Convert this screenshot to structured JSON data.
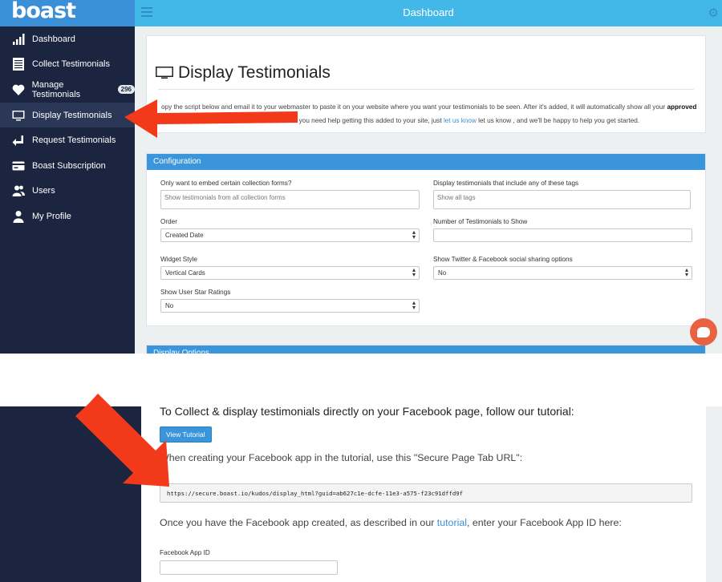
{
  "brand": {
    "logo_text": "boast",
    "color": "#3a8fd6"
  },
  "topbar": {
    "title": "Dashboard",
    "menu_icon": "hamburger-icon",
    "settings_icon": "gear-icon"
  },
  "sidebar": {
    "items": [
      {
        "label": "Dashboard",
        "icon": "bar-chart-icon"
      },
      {
        "label": "Collect Testimonials",
        "icon": "document-icon"
      },
      {
        "label": "Manage Testimonials",
        "icon": "heart-icon",
        "badge": "296"
      },
      {
        "label": "Display Testimonials",
        "icon": "monitor-icon",
        "active": true
      },
      {
        "label": "Request Testimonials",
        "icon": "request-icon"
      },
      {
        "label": "Boast Subscription",
        "icon": "credit-card-icon"
      },
      {
        "label": "Users",
        "icon": "users-icon"
      },
      {
        "label": "My Profile",
        "icon": "user-icon"
      }
    ]
  },
  "page": {
    "title": "Display Testimonials",
    "intro_line1_a": "opy the script below and email it to your webmaster to paste it on your website where you want your testimonials to be seen. After it's added, it will automatically show all your ",
    "intro_line1_b": "approved",
    "intro_line2_a": "hosen. If you need help getting this added to your site, just ",
    "intro_link": "let us know",
    "intro_line2_b": " let us know , and we'll be happy to help you get started."
  },
  "config": {
    "header": "Configuration",
    "collection_label": "Only want to embed certain collection forms?",
    "collection_placeholder": "Show testimonials from all collection forms",
    "tags_label": "Display testimonials that include any of these tags",
    "tags_placeholder": "Show all tags",
    "order_label": "Order",
    "order_value": "Created Date",
    "count_label": "Number of Testimonials to Show",
    "count_value": "",
    "widget_label": "Widget Style",
    "widget_value": "Vertical Cards",
    "social_label": "Show Twitter & Facebook social sharing options",
    "social_value": "No",
    "stars_label": "Show User Star Ratings",
    "stars_value": "No"
  },
  "display_options": {
    "header": "Display Options"
  },
  "facebook": {
    "heading": "To Collect & display testimonials directly on your Facebook page, follow our tutorial:",
    "tutorial_button": "View Tutorial",
    "secure_url_note": "When creating your Facebook app in the tutorial, use this \"Secure Page Tab URL\":",
    "secure_url": "https://secure.boast.io/kudos/display_html?guid=ab627c1e-dcfe-11e3-a575-f23c91dffd9f",
    "app_note_a": "Once you have the Facebook app created, as described in our ",
    "app_note_link": "tutorial",
    "app_note_b": ", enter your Facebook App ID here:",
    "app_id_label": "Facebook App ID",
    "app_id_value": ""
  },
  "colors": {
    "sidebar": "#1c2540",
    "topbar": "#42b8e8",
    "accent": "#3a95db",
    "arrow": "#f23a1b",
    "chat": "#e86242"
  },
  "annotations": {
    "arrow_icon": "red-arrow-icon",
    "chat_icon": "chat-bubble-icon"
  }
}
